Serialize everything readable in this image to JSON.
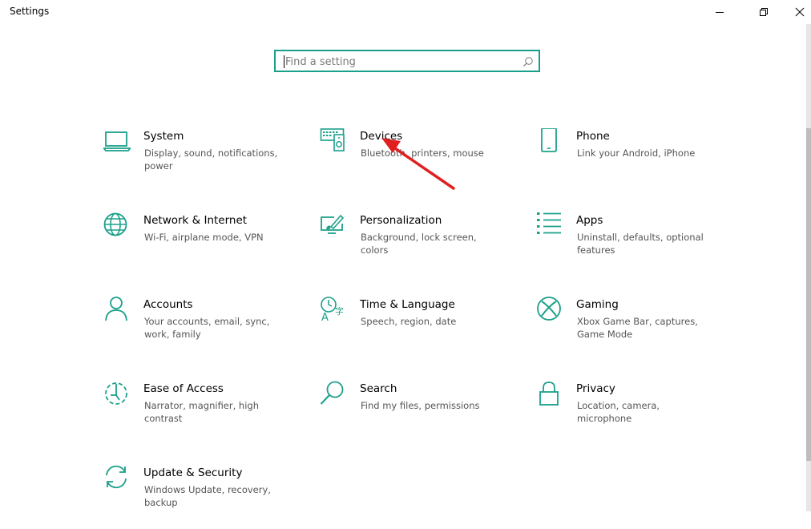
{
  "window": {
    "title": "Settings",
    "controls": [
      "minimize",
      "maximize",
      "close"
    ]
  },
  "search": {
    "placeholder": "Find a setting",
    "value": ""
  },
  "tiles": [
    {
      "title": "System",
      "desc": "Display, sound, notifications, power",
      "icon": "laptop-icon"
    },
    {
      "title": "Devices",
      "desc": "Bluetooth, printers, mouse",
      "icon": "devices-icon"
    },
    {
      "title": "Phone",
      "desc": "Link your Android, iPhone",
      "icon": "phone-icon"
    },
    {
      "title": "Network & Internet",
      "desc": "Wi-Fi, airplane mode, VPN",
      "icon": "globe-icon"
    },
    {
      "title": "Personalization",
      "desc": "Background, lock screen, colors",
      "icon": "paint-icon"
    },
    {
      "title": "Apps",
      "desc": "Uninstall, defaults, optional features",
      "icon": "apps-list-icon"
    },
    {
      "title": "Accounts",
      "desc": "Your accounts, email, sync, work, family",
      "icon": "person-icon"
    },
    {
      "title": "Time & Language",
      "desc": "Speech, region, date",
      "icon": "time-language-icon"
    },
    {
      "title": "Gaming",
      "desc": "Xbox Game Bar, captures, Game Mode",
      "icon": "xbox-icon"
    },
    {
      "title": "Ease of Access",
      "desc": "Narrator, magnifier, high contrast",
      "icon": "ease-of-access-icon"
    },
    {
      "title": "Search",
      "desc": "Find my files, permissions",
      "icon": "magnifier-icon"
    },
    {
      "title": "Privacy",
      "desc": "Location, camera, microphone",
      "icon": "lock-icon"
    },
    {
      "title": "Update & Security",
      "desc": "Windows Update, recovery, backup",
      "icon": "sync-icon"
    }
  ],
  "colors": {
    "accent": "#1aa08a",
    "annotation_arrow": "#e02020"
  }
}
